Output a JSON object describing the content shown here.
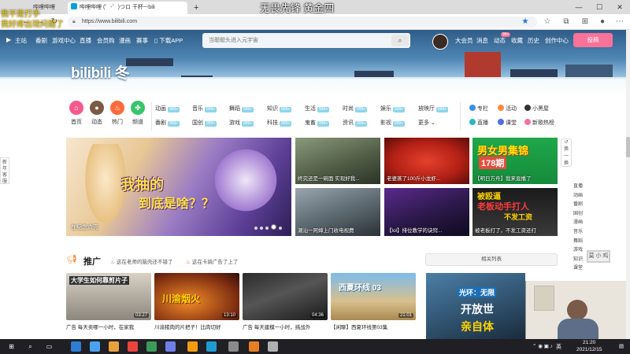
{
  "overlay": {
    "title": "无畏先锋 黄金四",
    "corner_line1": "我不是打手",
    "corner_line2": "我好疼出现问题了"
  },
  "browser": {
    "tab_inactive": "哔哩哔哩",
    "tab_active": "哔哩哔哩 (゜-゜)つロ 干杯~-bili",
    "url": "https://www.bilibili.com",
    "win_min": "—",
    "win_max": "☐",
    "win_close": "✕"
  },
  "topnav": {
    "left_items": [
      "主站",
      "番剧",
      "游戏中心",
      "直播",
      "会员购",
      "漫画",
      "赛事"
    ],
    "download": "下载APP",
    "right_items": [
      "大会员",
      "消息",
      "动态",
      "收藏",
      "历史",
      "创作中心"
    ],
    "dynamic_badge": "99+",
    "upload": "投稿"
  },
  "search": {
    "placeholder": "当聪聪头进入元宇宙"
  },
  "logo": "bilibili 冬",
  "channels": {
    "big": [
      {
        "label": "首页",
        "glyph": "⌂",
        "color": "#f45a8d"
      },
      {
        "label": "动态",
        "glyph": "●",
        "color": "#7a5a45"
      },
      {
        "label": "热门",
        "glyph": "♨",
        "color": "#ff6b3d"
      },
      {
        "label": "频道",
        "glyph": "✤",
        "color": "#38c46b"
      }
    ],
    "col1": [
      {
        "label": "动画",
        "count": "999+"
      },
      {
        "label": "番剧",
        "count": "999+"
      }
    ],
    "col2": [
      {
        "label": "音乐",
        "count": "999+"
      },
      {
        "label": "国创",
        "count": "999+"
      }
    ],
    "col3": [
      {
        "label": "舞蹈",
        "count": "999+"
      },
      {
        "label": "游戏",
        "count": "999+"
      }
    ],
    "col4": [
      {
        "label": "知识",
        "count": "999+"
      },
      {
        "label": "科技",
        "count": "999+"
      }
    ],
    "col5": [
      {
        "label": "生活",
        "count": "999+"
      },
      {
        "label": "鬼畜",
        "count": "999+"
      }
    ],
    "col6": [
      {
        "label": "时尚",
        "count": "999+"
      },
      {
        "label": "资讯",
        "count": "999+"
      }
    ],
    "col7": [
      {
        "label": "娱乐",
        "count": "999+"
      },
      {
        "label": "影视",
        "count": "999+"
      }
    ],
    "col8": [
      {
        "label": "放映厅",
        "count": "999+"
      },
      {
        "label": "更多"
      }
    ],
    "extra": [
      {
        "label": "专栏",
        "color": "#3c8ce7"
      },
      {
        "label": "活动",
        "color": "#ff8b3d"
      },
      {
        "label": "小黑屋",
        "color": "#333333"
      },
      {
        "label": "直播",
        "color": "#2bb8c4"
      },
      {
        "label": "课堂",
        "color": "#4c6fe0"
      },
      {
        "label": "新歌热榜",
        "color": "#fb7299"
      }
    ]
  },
  "carousel": {
    "caption": "在纪念点亮",
    "headline1": "我抽的",
    "headline2": "到底是啥？？"
  },
  "grid": [
    {
      "caption": "终究还是一碗面 实现好我..."
    },
    {
      "caption": "老婆蒸了100斤小龙虾..."
    },
    {
      "caption": "【明日方舟】我来直播了",
      "t1": "男女男集锦",
      "t2": "178期"
    },
    {
      "caption": "潮汕一阿婶上门收电视费"
    },
    {
      "caption": "【lol】排位教学的诀窍..."
    },
    {
      "caption": "被老板打了，不发工资还打",
      "t1": "被殴逼",
      "t2": "老板动手打人",
      "t3": "不发工资"
    }
  ],
  "side_tools": [
    "↺",
    "换",
    "一",
    "换"
  ],
  "side_nav": [
    "直播",
    "动画",
    "番剧",
    "国创",
    "漫画",
    "音乐",
    "舞蹈",
    "游戏",
    "知识",
    "课堂"
  ],
  "left_tab": "新年客服",
  "stamp": "莫 小 鸡",
  "promo": {
    "title": "推广",
    "item1": "这在老师的脑壳还不错了",
    "item2": "这在卡骑广告了上了",
    "rank": "相关列表"
  },
  "videos": [
    {
      "title": "广告 每天卖哪一小时，在家我",
      "thumb": "大学生如何靠剪片子",
      "dur": "03:27"
    },
    {
      "title": "川渝猪肉的片把子！比肉切好",
      "thumb": "川渝烟火",
      "dur": "13:10"
    },
    {
      "title": "广告 每天建模一小时，挑战外",
      "thumb": "",
      "dur": "04:36"
    },
    {
      "title": "【闲聊】西夏环线第03集",
      "thumb": "西夏环线 03",
      "dur": "21:01"
    }
  ],
  "big_ad": {
    "line1": "光环：无限",
    "line2": "开放世",
    "line3": "亲自体"
  },
  "taskbar": {
    "time": "21:20",
    "date": "2021/12/15",
    "lang": "英",
    "icons": [
      "#2d7dd2",
      "#4aa3f0",
      "#e9a13b",
      "#e8453c",
      "#3b9b5b",
      "#6f7fe8",
      "#f39c12",
      "#1f9bd1",
      "#8a8a8a",
      "#e67e22",
      "#b0b0b0"
    ]
  }
}
